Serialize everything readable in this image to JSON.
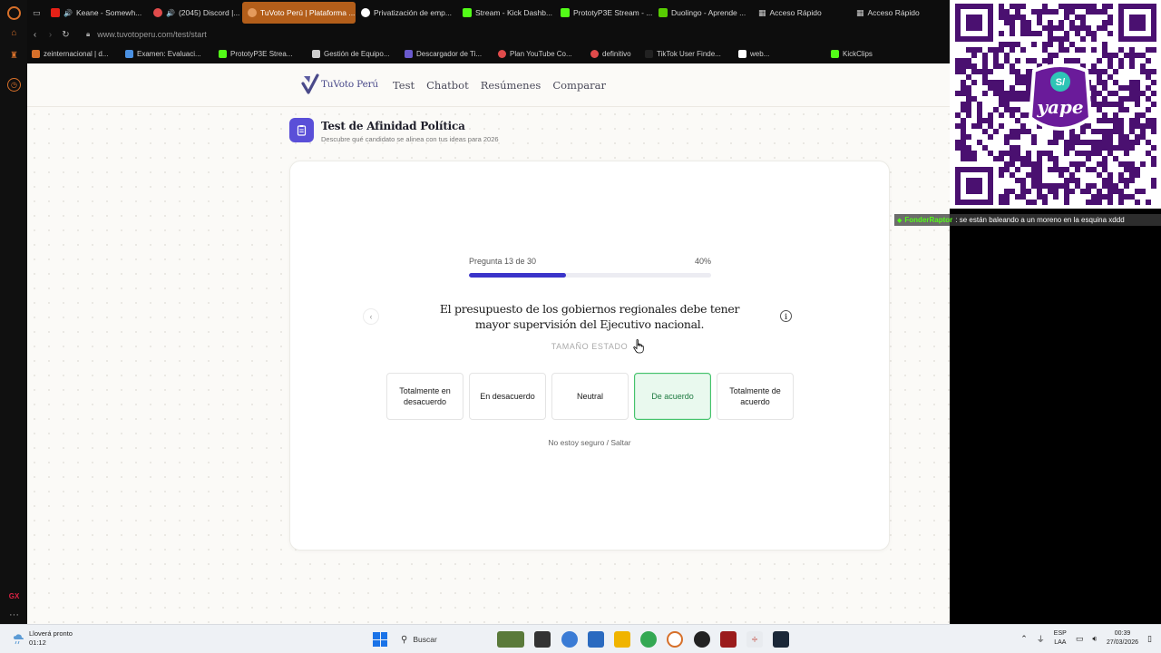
{
  "browser": {
    "tabs": [
      {
        "label": "",
        "color": "#666666"
      },
      {
        "label": "Keane - Somewh...",
        "color": "#e62117"
      },
      {
        "label": "(2045) Discord |...",
        "color": "#e04b4b"
      },
      {
        "label": "TuVoto Perú | Plataforma ...",
        "color": "#d7702a",
        "active": true
      },
      {
        "label": "Privatización de emp...",
        "color": "#ffffff"
      },
      {
        "label": "Stream - Kick Dashb...",
        "color": "#53fc18"
      },
      {
        "label": "PrototyP3E Stream - ...",
        "color": "#53fc18"
      },
      {
        "label": "Duolingo - Aprende ...",
        "color": "#58cc02"
      },
      {
        "label": "Acceso Rápido",
        "color": "#888888"
      },
      {
        "label": "Acceso Rápido",
        "color": "#888888"
      }
    ],
    "url": "www.tuvotoperu.com/test/start",
    "bookmarks": [
      {
        "label": "zeinternacional | d...",
        "color": "#d7702a"
      },
      {
        "label": "Examen: Evaluaci...",
        "color": "#4a90e2"
      },
      {
        "label": "PrototyP3E Strea...",
        "color": "#53fc18"
      },
      {
        "label": "Gestión de Equipo...",
        "color": "#cccccc"
      },
      {
        "label": "Descargador de Ti...",
        "color": "#6a5acd"
      },
      {
        "label": "Plan YouTube Co...",
        "color": "#e04b4b"
      },
      {
        "label": "definitivo",
        "color": "#e04b4b"
      },
      {
        "label": "TikTok User Finde...",
        "color": "#222222"
      },
      {
        "label": "web...",
        "color": "#ffffff"
      },
      {
        "label": "KickClips",
        "color": "#53fc18"
      }
    ]
  },
  "site": {
    "logo_text": "TuVoto Perú",
    "nav": [
      "Test",
      "Chatbot",
      "Resúmenes",
      "Comparar"
    ],
    "title": "Test de Afinidad Política",
    "subtitle": "Descubre qué candidato se alinea con tus ideas para 2026"
  },
  "quiz": {
    "progress_label": "Pregunta 13 de 30",
    "progress_percent_label": "40%",
    "progress_fraction": 0.4,
    "question": "El presupuesto de los gobiernos regionales debe tener mayor supervisión del Ejecutivo nacional.",
    "category": "TAMAÑO ESTADO",
    "options": [
      {
        "label": "Totalmente en desacuerdo",
        "selected": false
      },
      {
        "label": "En desacuerdo",
        "selected": false
      },
      {
        "label": "Neutral",
        "selected": false
      },
      {
        "label": "De acuerdo",
        "selected": true
      },
      {
        "label": "Totalmente de acuerdo",
        "selected": false
      }
    ],
    "skip_label": "No estoy seguro / Saltar"
  },
  "overlay": {
    "yape_text": "yape",
    "yape_symbol": "S/",
    "chat_user": "FonderRaptor",
    "chat_message": ": se están baleando a un moreno en la esquina xddd"
  },
  "taskbar": {
    "weather_line1": "Lloverá pronto",
    "weather_line2": "01:12",
    "search_placeholder": "Buscar",
    "lang_line1": "ESP",
    "lang_line2": "LAA",
    "time": "00:39",
    "date": "27/03/2026"
  },
  "colors": {
    "accent": "#3a34c9",
    "selected_green": "#44c36a",
    "title_icon_bg": "#5a4fd8",
    "opera_orange": "#d7702a"
  }
}
